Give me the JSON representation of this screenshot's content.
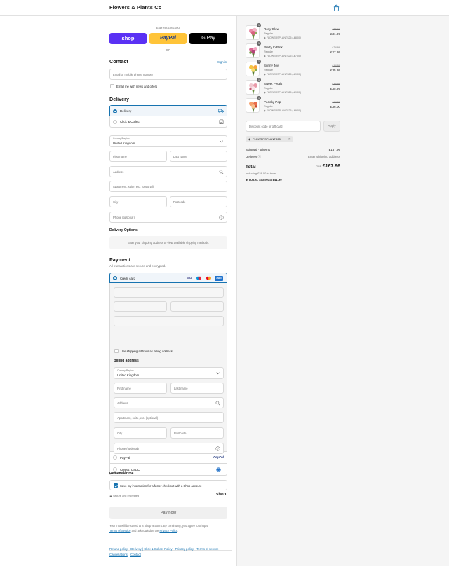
{
  "header": {
    "brand": "Flowers & Plants Co",
    "cart_icon": "shopping-bag-icon"
  },
  "express": {
    "label": "Express checkout",
    "shop_label": "shop",
    "paypal_label": "PayPal",
    "gpay_label": "G Pay",
    "or_label": "OR",
    "colors": {
      "shop": "#5a31f4",
      "paypal": "#ffc439",
      "gpay": "#000000"
    }
  },
  "contact": {
    "title": "Contact",
    "sign_in": "Sign in",
    "placeholder": "Email or mobile phone number",
    "news_label": "Email me with news and offers"
  },
  "delivery": {
    "title": "Delivery",
    "options": [
      {
        "label": "Delivery",
        "icon": "truck-icon",
        "selected": true
      },
      {
        "label": "Click & Collect",
        "icon": "store-icon",
        "selected": false
      }
    ],
    "country_label": "Country/Region",
    "country_value": "United Kingdom",
    "first_name": "First name",
    "last_name": "Last name",
    "address": "Address",
    "apartment": "Apartment, suite, etc. (optional)",
    "city": "City",
    "postcode": "Postcode",
    "phone": "Phone (optional)"
  },
  "delivery_options": {
    "title": "Delivery Options",
    "message": "Enter your shipping address to view available shipping methods."
  },
  "payment": {
    "title": "Payment",
    "subtitle": "All transactions are secure and encrypted.",
    "credit_card": "Credit card",
    "card_brands": [
      "VISA",
      "Maestro",
      "Mastercard",
      "AMEX"
    ],
    "use_shipping": "Use shipping address as billing address",
    "billing_title": "Billing address",
    "billing": {
      "country_label": "Country/Region",
      "country_value": "United Kingdom",
      "first_name": "First name",
      "last_name": "Last name",
      "address": "Address",
      "apartment": "Apartment, suite, etc. (optional)",
      "city": "City",
      "postcode": "Postcode",
      "phone": "Phone (optional)"
    },
    "paypal": "PayPal",
    "paypal_logo": "PayPal",
    "crypto": "Crypto: USDC"
  },
  "remember": {
    "title": "Remember me",
    "save_label": "Save my information for a faster checkout with a Shop account",
    "secure": "Secure and encrypted",
    "shop_logo": "shop"
  },
  "pay_now": "Pay now",
  "legal": {
    "text_before": "Your info will be saved to a Shop account. By continuing, you agree to Shop's",
    "terms": "Terms of Service",
    "and": "and acknowledge the",
    "privacy": "Privacy Policy",
    "period": "."
  },
  "footer_links": [
    "Refund policy",
    "Delivery | Click & Collect Policy",
    "Privacy policy",
    "Terms of service",
    "Cancellations",
    "Contact"
  ],
  "cart": {
    "items": [
      {
        "name": "Rosy Glow",
        "variant": "Regular",
        "discount": "FLOWERSPLANTS25 (-£8.00)",
        "old_price": "£39.99",
        "price": "£31.99",
        "qty": "1"
      },
      {
        "name": "Pretty In Pink",
        "variant": "Regular",
        "discount": "FLOWERSPLANTS25 (-£7.00)",
        "old_price": "£34.99",
        "price": "£27.99",
        "qty": "1"
      },
      {
        "name": "Sunny Joy",
        "variant": "Regular",
        "discount": "FLOWERSPLANTS25 (-£9.00)",
        "old_price": "£44.99",
        "price": "£35.99",
        "qty": "1"
      },
      {
        "name": "Sweet Petals",
        "variant": "Regular",
        "discount": "FLOWERSPLANTS25 (-£9.00)",
        "old_price": "£44.99",
        "price": "£35.99",
        "qty": "1"
      },
      {
        "name": "Peachy Pop",
        "variant": "Regular",
        "discount": "FLOWERSPLANTS25 (-£9.00)",
        "old_price": "£44.99",
        "price": "£36.00",
        "qty": "1"
      }
    ],
    "discount_placeholder": "Discount code or gift card",
    "apply": "Apply",
    "applied_code": "FLOWERSPLANTS25",
    "subtotal_label": "Subtotal · 5 items",
    "subtotal_value": "£167.96",
    "delivery_label": "Delivery",
    "delivery_value": "Enter shipping address",
    "total_label": "Total",
    "currency": "GBP",
    "total_value": "£167.96",
    "taxes": "Including £28.00 in taxes",
    "savings_label": "TOTAL SAVINGS",
    "savings_value": "£41.99"
  }
}
